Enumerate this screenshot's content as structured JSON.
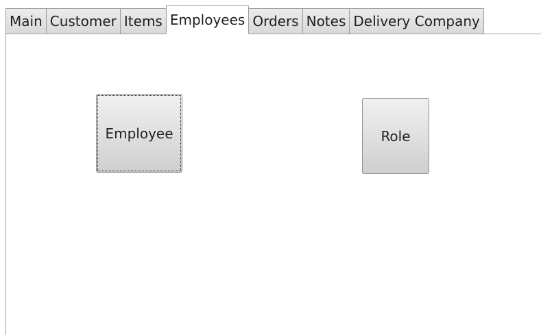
{
  "tabs": [
    {
      "label": "Main"
    },
    {
      "label": "Customer"
    },
    {
      "label": "Items"
    },
    {
      "label": "Employees"
    },
    {
      "label": "Orders"
    },
    {
      "label": "Notes"
    },
    {
      "label": "Delivery Company"
    }
  ],
  "active_tab": "Employees",
  "employees_panel": {
    "employee_button_label": "Employee",
    "role_button_label": "Role"
  }
}
